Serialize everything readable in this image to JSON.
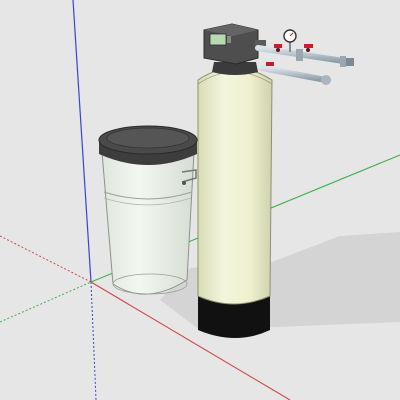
{
  "scene": {
    "background": "#e6e6e6",
    "axis_colors": {
      "red": "#d04848",
      "green": "#3fb24a",
      "blue": "#3a42d8"
    },
    "objects": [
      "brine-tank",
      "resin-tank",
      "control-valve",
      "pressure-gauge",
      "bypass-piping",
      "ground-shadow"
    ],
    "colors": {
      "tank_body": "#eef0cf",
      "tank_base": "#111111",
      "brine_body": "#eef3ec",
      "brine_lid": "#4a4a4a",
      "valve_head": "#4e4e4e",
      "display": "#b6dcae",
      "pipe": "#b9c6cf",
      "valve_handles": "#c61e2c",
      "shadow": "#d0d0d0"
    }
  }
}
